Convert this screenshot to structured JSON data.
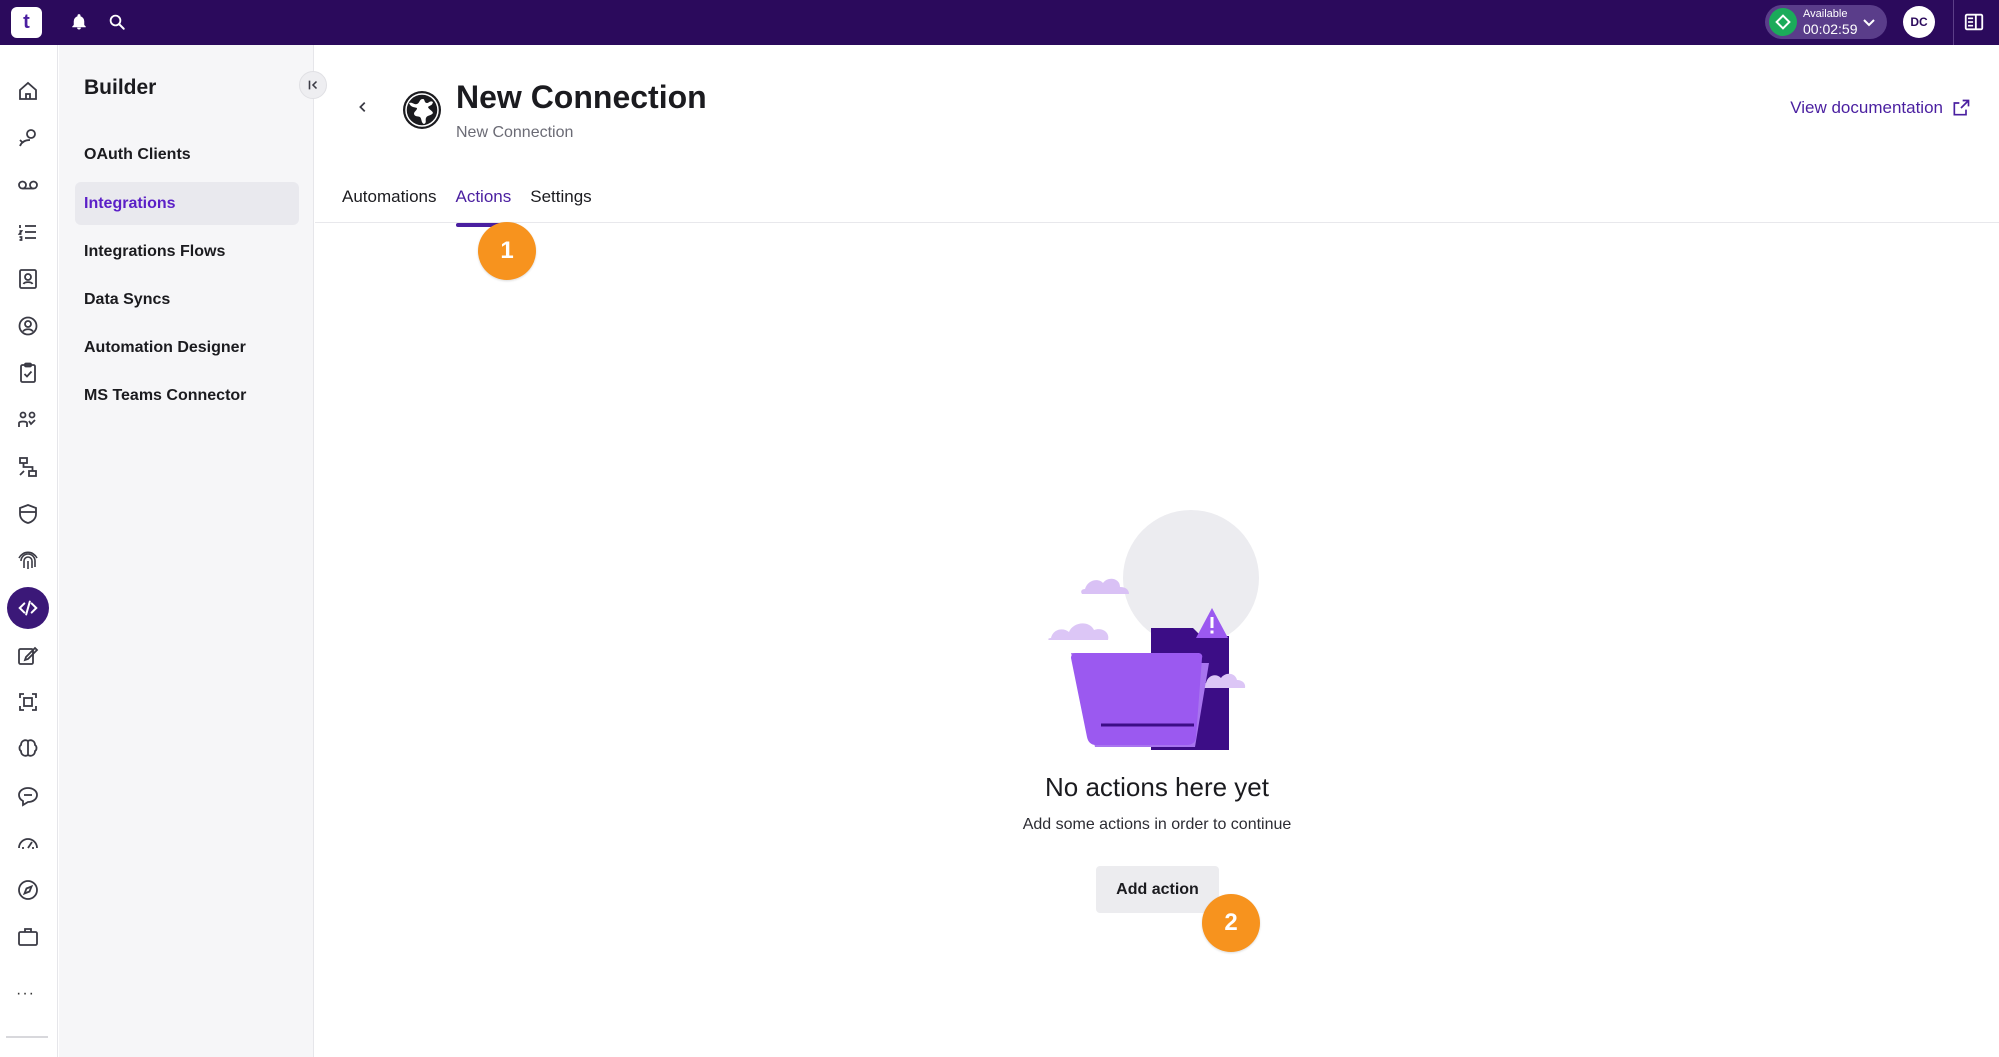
{
  "topbar": {
    "logo_text": "t",
    "status": {
      "label": "Available",
      "timer": "00:02:59",
      "color": "#1bab5a"
    },
    "avatar_initials": "DC"
  },
  "rail": {
    "icons": [
      "home-icon",
      "routing-icon",
      "voicemail-icon",
      "queue-list-icon",
      "contacts-icon",
      "agent-icon",
      "task-icon",
      "team-icon",
      "flow-icon",
      "shield-icon",
      "fingerprint-icon",
      "code-icon",
      "edit-icon",
      "screen-capture-icon",
      "brain-icon",
      "chat-bubble-icon",
      "speedometer-icon",
      "compass-icon",
      "briefcase-icon"
    ],
    "active": "code-icon",
    "more_label": "···"
  },
  "panel": {
    "title": "Builder",
    "items": [
      {
        "label": "OAuth Clients",
        "active": false
      },
      {
        "label": "Integrations",
        "active": true
      },
      {
        "label": "Integrations Flows",
        "active": false
      },
      {
        "label": "Data Syncs",
        "active": false
      },
      {
        "label": "Automation Designer",
        "active": false
      },
      {
        "label": "MS Teams Connector",
        "active": false
      }
    ]
  },
  "main": {
    "title": "New Connection",
    "subtitle": "New Connection",
    "doc_link": "View documentation",
    "tabs": [
      {
        "label": "Automations",
        "active": false
      },
      {
        "label": "Actions",
        "active": true
      },
      {
        "label": "Settings",
        "active": false
      }
    ],
    "empty_state": {
      "title": "No actions here yet",
      "description": "Add some actions in order to continue",
      "button": "Add action"
    },
    "markers": [
      "1",
      "2"
    ]
  },
  "colors": {
    "topbar": "#2b0a5c",
    "accent": "#4a1fa0",
    "marker": "#f7931e",
    "folder": "#9b59f0"
  }
}
